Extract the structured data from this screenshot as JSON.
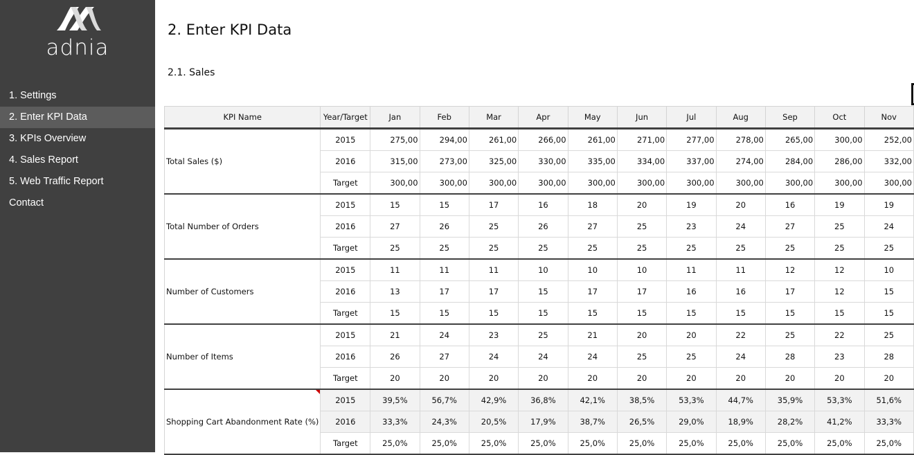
{
  "sidebar": {
    "logo_text": "adnia",
    "logo_icon": "adnia-logo-icon",
    "items": [
      {
        "label": "1. Settings",
        "active": false
      },
      {
        "label": "2. Enter KPI Data",
        "active": true
      },
      {
        "label": "3. KPIs Overview",
        "active": false
      },
      {
        "label": "4. Sales Report",
        "active": false
      },
      {
        "label": "5. Web Traffic Report",
        "active": false
      },
      {
        "label": "Contact",
        "active": false
      }
    ]
  },
  "page": {
    "title": "2. Enter KPI Data",
    "section": "2.1. Sales"
  },
  "table": {
    "headers": [
      "KPI Name",
      "Year/Target",
      "Jan",
      "Feb",
      "Mar",
      "Apr",
      "May",
      "Jun",
      "Jul",
      "Aug",
      "Sep",
      "Oct",
      "Nov"
    ],
    "groups": [
      {
        "name": "Total Sales ($)",
        "align": "right",
        "rows": [
          {
            "label": "2015",
            "values": [
              "275,00",
              "294,00",
              "261,00",
              "266,00",
              "261,00",
              "271,00",
              "277,00",
              "278,00",
              "265,00",
              "300,00",
              "252,00"
            ]
          },
          {
            "label": "2016",
            "values": [
              "315,00",
              "273,00",
              "325,00",
              "330,00",
              "335,00",
              "334,00",
              "337,00",
              "274,00",
              "284,00",
              "286,00",
              "332,00"
            ]
          },
          {
            "label": "Target",
            "values": [
              "300,00",
              "300,00",
              "300,00",
              "300,00",
              "300,00",
              "300,00",
              "300,00",
              "300,00",
              "300,00",
              "300,00",
              "300,00"
            ]
          }
        ]
      },
      {
        "name": "Total Number of Orders",
        "align": "center",
        "rows": [
          {
            "label": "2015",
            "values": [
              "15",
              "15",
              "17",
              "16",
              "18",
              "20",
              "19",
              "20",
              "16",
              "19",
              "19"
            ]
          },
          {
            "label": "2016",
            "values": [
              "27",
              "26",
              "25",
              "26",
              "27",
              "25",
              "23",
              "24",
              "27",
              "25",
              "24"
            ]
          },
          {
            "label": "Target",
            "values": [
              "25",
              "25",
              "25",
              "25",
              "25",
              "25",
              "25",
              "25",
              "25",
              "25",
              "25"
            ]
          }
        ]
      },
      {
        "name": "Number of Customers",
        "align": "center",
        "rows": [
          {
            "label": "2015",
            "values": [
              "11",
              "11",
              "11",
              "10",
              "10",
              "10",
              "11",
              "11",
              "12",
              "12",
              "10"
            ]
          },
          {
            "label": "2016",
            "values": [
              "13",
              "17",
              "17",
              "15",
              "17",
              "17",
              "16",
              "16",
              "17",
              "12",
              "15"
            ]
          },
          {
            "label": "Target",
            "values": [
              "15",
              "15",
              "15",
              "15",
              "15",
              "15",
              "15",
              "15",
              "15",
              "15",
              "15"
            ]
          }
        ]
      },
      {
        "name": "Number of Items",
        "align": "center",
        "rows": [
          {
            "label": "2015",
            "values": [
              "21",
              "24",
              "23",
              "25",
              "21",
              "20",
              "20",
              "22",
              "25",
              "22",
              "25"
            ]
          },
          {
            "label": "2016",
            "values": [
              "26",
              "27",
              "24",
              "24",
              "24",
              "25",
              "25",
              "24",
              "28",
              "23",
              "28"
            ]
          },
          {
            "label": "Target",
            "values": [
              "20",
              "20",
              "20",
              "20",
              "20",
              "20",
              "20",
              "20",
              "20",
              "20",
              "20"
            ]
          }
        ]
      },
      {
        "name": "Shopping Cart Abandonment Rate (%)",
        "align": "center",
        "comment": true,
        "shaded_rows": [
          0,
          1
        ],
        "rows": [
          {
            "label": "2015",
            "values": [
              "39,5%",
              "56,7%",
              "42,9%",
              "36,8%",
              "42,1%",
              "38,5%",
              "53,3%",
              "44,7%",
              "35,9%",
              "53,3%",
              "51,6%"
            ]
          },
          {
            "label": "2016",
            "values": [
              "33,3%",
              "24,3%",
              "20,5%",
              "17,9%",
              "38,7%",
              "26,5%",
              "29,0%",
              "18,9%",
              "28,2%",
              "41,2%",
              "33,3%"
            ]
          },
          {
            "label": "Target",
            "values": [
              "25,0%",
              "25,0%",
              "25,0%",
              "25,0%",
              "25,0%",
              "25,0%",
              "25,0%",
              "25,0%",
              "25,0%",
              "25,0%",
              "25,0%"
            ]
          }
        ]
      }
    ]
  }
}
